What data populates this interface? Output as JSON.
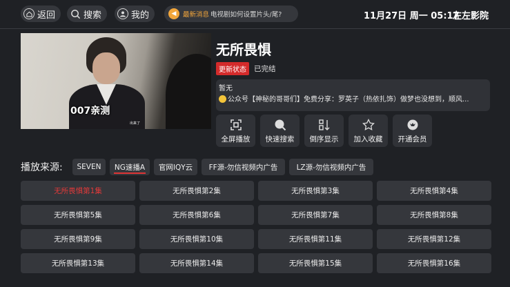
{
  "topbar": {
    "back_label": "返回",
    "search_label": "搜索",
    "mine_label": "我的",
    "news_tag": "最新消息",
    "news_text": "电视剧如何设置片头/尾?",
    "datetime": "11月27日 周一 05:17",
    "brand": "左左影院"
  },
  "video": {
    "caption": "007亲测",
    "subtitle": "出来了"
  },
  "show": {
    "title": "无所畏惧",
    "status_badge": "更新状态",
    "status_text": "已完结",
    "desc_line1": "暂无",
    "desc_line2": "公众号【神秘的哥哥们】免费分享：罗英子（热依扎饰）做梦也没想到，顺风..."
  },
  "actions": [
    {
      "label": "全屏播放",
      "icon": "fullscreen-icon"
    },
    {
      "label": "快速搜索",
      "icon": "search-icon"
    },
    {
      "label": "倒序显示",
      "icon": "sort-icon"
    },
    {
      "label": "加入收藏",
      "icon": "star-icon"
    },
    {
      "label": "开通会员",
      "icon": "vip-icon"
    }
  ],
  "sources": {
    "label": "播放来源:",
    "tabs": [
      "SEVEN",
      "NG速播A",
      "官网IQY云",
      "FF源-勿信视频内广告",
      "LZ源-勿信视频内广告"
    ],
    "active_index": 1
  },
  "episodes": [
    "无所畏惧第1集",
    "无所畏惧第2集",
    "无所畏惧第3集",
    "无所畏惧第4集",
    "无所畏惧第5集",
    "无所畏惧第6集",
    "无所畏惧第7集",
    "无所畏惧第8集",
    "无所畏惧第9集",
    "无所畏惧第10集",
    "无所畏惧第11集",
    "无所畏惧第12集",
    "无所畏惧第13集",
    "无所畏惧第14集",
    "无所畏惧第15集",
    "无所畏惧第16集"
  ],
  "current_episode_index": 0,
  "colors": {
    "accent_red": "#d42b2b",
    "news_orange": "#f2a63b",
    "background": "#1f2125"
  }
}
